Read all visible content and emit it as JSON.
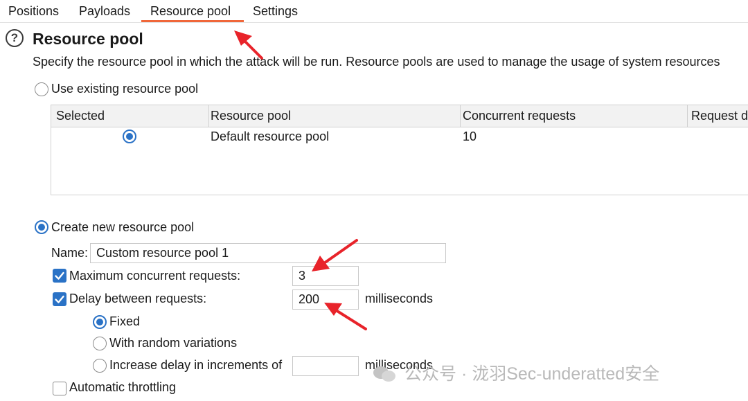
{
  "tabs": [
    {
      "label": "Positions"
    },
    {
      "label": "Payloads"
    },
    {
      "label": "Resource pool"
    },
    {
      "label": "Settings"
    }
  ],
  "section": {
    "title": "Resource pool",
    "description": "Specify the resource pool in which the attack will be run. Resource pools are used to manage the usage of system resources"
  },
  "existing": {
    "label": "Use existing resource pool",
    "table": {
      "headers": [
        "Selected",
        "Resource pool",
        "Concurrent requests",
        "Request d"
      ],
      "rows": [
        {
          "resource_pool": "Default resource pool",
          "concurrent_requests": "10"
        }
      ]
    }
  },
  "create": {
    "label": "Create new resource pool",
    "name_label": "Name:",
    "name_value": "Custom resource pool 1",
    "max_concurrent_label": "Maximum concurrent requests:",
    "max_concurrent_value": "3",
    "delay_label": "Delay between requests:",
    "delay_value": "200",
    "delay_unit": "milliseconds",
    "fixed_label": "Fixed",
    "random_label": "With random variations",
    "increase_label": "Increase delay in increments of",
    "increase_value": "",
    "increase_unit": "milliseconds",
    "auto_throttle_label": "Automatic throttling"
  },
  "watermark": "公众号 · 泷羽Sec-underatted安全",
  "colors": {
    "accent": "#2a72c6",
    "tab_underline": "#f0673a",
    "annotation_arrow": "#e8232a"
  }
}
